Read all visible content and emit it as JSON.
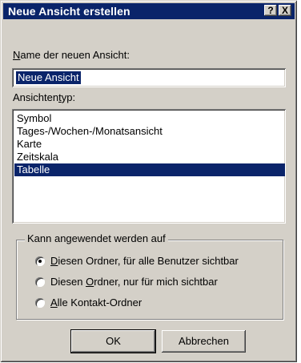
{
  "dialog": {
    "title": "Neue Ansicht erstellen",
    "help_button": "?",
    "close_button": "X"
  },
  "name_section": {
    "label_prefix": "",
    "label_mnemonic": "N",
    "label_rest": "ame der neuen Ansicht:",
    "value": "Neue Ansicht"
  },
  "type_section": {
    "label_prefix": "Ansichten",
    "label_mnemonic": "t",
    "label_rest": "yp:",
    "items": [
      {
        "label": "Symbol",
        "selected": false
      },
      {
        "label": "Tages-/Wochen-/Monatsansicht",
        "selected": false
      },
      {
        "label": "Karte",
        "selected": false
      },
      {
        "label": "Zeitskala",
        "selected": false
      },
      {
        "label": "Tabelle",
        "selected": true
      }
    ]
  },
  "apply_group": {
    "legend": "Kann angewendet werden auf",
    "options": [
      {
        "prefix": "",
        "mnemonic": "D",
        "rest": "iesen Ordner, für alle Benutzer sichtbar",
        "checked": true
      },
      {
        "prefix": "Diesen ",
        "mnemonic": "O",
        "rest": "rdner, nur für mich sichtbar",
        "checked": false
      },
      {
        "prefix": "",
        "mnemonic": "A",
        "rest": "lle Kontakt-Ordner",
        "checked": false
      }
    ]
  },
  "buttons": {
    "ok": "OK",
    "cancel": "Abbrechen"
  }
}
